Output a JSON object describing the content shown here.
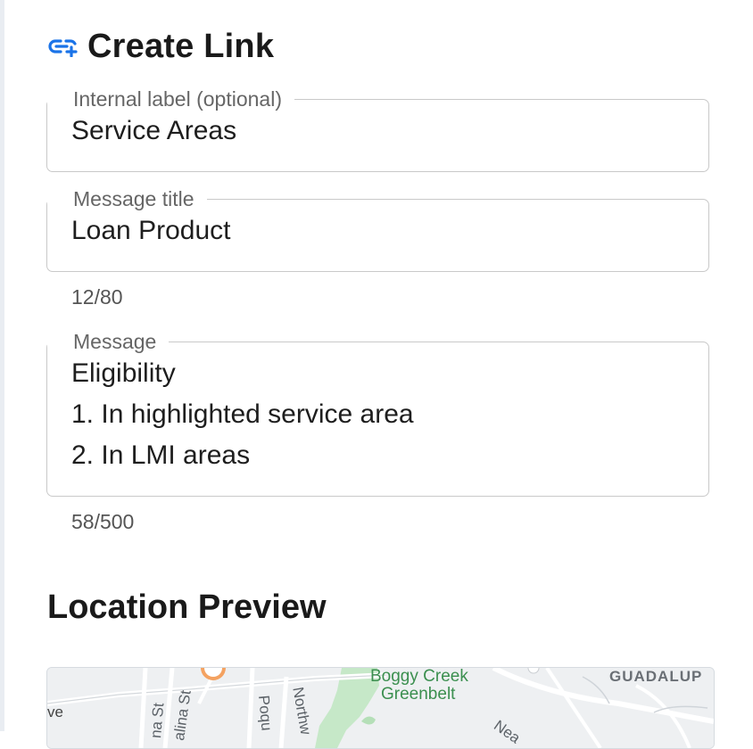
{
  "header": {
    "title": "Create Link",
    "icon": "add-link-icon",
    "accent": "#1a73e8"
  },
  "form": {
    "internal_label": {
      "legend": "Internal label (optional)",
      "value": "Service Areas"
    },
    "message_title": {
      "legend": "Message title",
      "value": "Loan Product",
      "counter": "12/80"
    },
    "message": {
      "legend": "Message",
      "lines": [
        "Eligibility",
        "1. In highlighted service area",
        "2. In LMI areas"
      ],
      "counter": "58/500"
    }
  },
  "location_preview": {
    "title": "Location Preview",
    "map_labels": {
      "park": "Boggy Creek\nGreenbelt",
      "park_line1": "Boggy Creek",
      "park_line2": "Greenbelt",
      "district": "GUADALUP",
      "ave": "ve",
      "street_a": "na St",
      "street_b": "alina St",
      "street_c": "Poqu",
      "street_d": "Northw",
      "street_e": "Nea"
    }
  }
}
